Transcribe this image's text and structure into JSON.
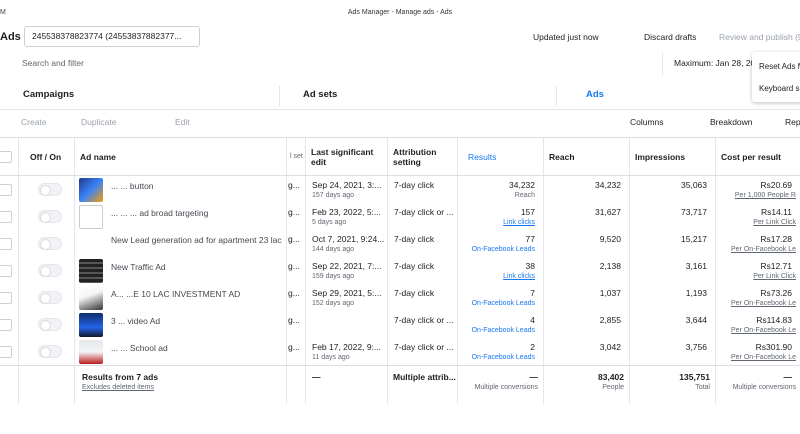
{
  "window": {
    "corner": "M",
    "title": "Ads Manager - Manage ads - Ads"
  },
  "topbar": {
    "ads_label": "Ads",
    "account": "245538378823774 (24553837882377...",
    "updated": "Updated just now",
    "discard": "Discard drafts",
    "review": "Review and publish (9"
  },
  "search": {
    "placeholder": "Search and filter",
    "max_date": "Maximum: Jan 28, 20"
  },
  "dropdown": {
    "items": [
      "Reset Ads M",
      "Keyboard s"
    ]
  },
  "tabs": {
    "campaigns": "Campaigns",
    "adsets": "Ad sets",
    "ads": "Ads"
  },
  "toolbar": {
    "create": "Create",
    "duplicate": "Duplicate",
    "edit": "Edit",
    "columns": "Columns",
    "breakdown": "Breakdown",
    "reports": "Rep"
  },
  "table": {
    "headers": {
      "off_on": "Off / On",
      "ad_name": "Ad name",
      "ad_set": "l set",
      "last_edit": "Last significant edit",
      "attribution": "Attribution setting",
      "results": "Results",
      "reach": "Reach",
      "impressions": "Impressions",
      "cost": "Cost per result"
    },
    "rows": [
      {
        "name": "... ... button",
        "adset": "g...",
        "edit": "Sep 24, 2021, 3:...",
        "edit_ago": "157 days ago",
        "attr": "7-day click",
        "results": "34,232",
        "results_sub": "Reach",
        "reach": "34,232",
        "impr": "35,063",
        "cost": "Rs20.69",
        "cost_sub": "Per 1,000 People R"
      },
      {
        "name": "... ... ... ad broad targeting",
        "adset": "g...",
        "edit": "Feb 23, 2022, 5:...",
        "edit_ago": "5 days ago",
        "attr": "7-day click or ...",
        "results": "157",
        "results_sub": "Link clicks",
        "reach": "31,627",
        "impr": "73,717",
        "cost": "Rs14.11",
        "cost_sub": "Per Link Click"
      },
      {
        "name": "New Lead generation ad for apartment 23 lac",
        "adset": "g...",
        "edit": "Oct 7, 2021, 9:24...",
        "edit_ago": "144 days ago",
        "attr": "7-day click",
        "results": "77",
        "results_sub": "On-Facebook Leads",
        "reach": "9,520",
        "impr": "15,217",
        "cost": "Rs17.28",
        "cost_sub": "Per On-Facebook Le"
      },
      {
        "name": "New Traffic Ad",
        "adset": "g...",
        "edit": "Sep 22, 2021, 7:...",
        "edit_ago": "159 days ago",
        "attr": "7-day click",
        "results": "38",
        "results_sub": "Link clicks",
        "reach": "2,138",
        "impr": "3,161",
        "cost": "Rs12.71",
        "cost_sub": "Per Link Click"
      },
      {
        "name": "A... ...E 10 LAC INVESTMENT AD",
        "adset": "g...",
        "edit": "Sep 29, 2021, 5:...",
        "edit_ago": "152 days ago",
        "attr": "7-day click",
        "results": "7",
        "results_sub": "On-Facebook Leads",
        "reach": "1,037",
        "impr": "1,193",
        "cost": "Rs73.26",
        "cost_sub": "Per On-Facebook Le"
      },
      {
        "name": "3 ... video Ad",
        "adset": "g...",
        "edit": "",
        "edit_ago": "",
        "attr": "7-day click or ...",
        "results": "4",
        "results_sub": "On-Facebook Leads",
        "reach": "2,855",
        "impr": "3,644",
        "cost": "Rs114.83",
        "cost_sub": "Per On-Facebook Le"
      },
      {
        "name": "... ... School ad",
        "adset": "g...",
        "edit": "Feb 17, 2022, 9:...",
        "edit_ago": "11 days ago",
        "attr": "7-day click or ...",
        "results": "2",
        "results_sub": "On-Facebook Leads",
        "reach": "3,042",
        "impr": "3,756",
        "cost": "Rs301.90",
        "cost_sub": "Per On-Facebook Le"
      }
    ],
    "totals": {
      "label": "Results from 7 ads",
      "sub": "Excludes deleted items",
      "edit": "—",
      "attr": "Multiple attrib...",
      "results": "—",
      "results_sub": "Multiple conversions",
      "reach": "83,402",
      "reach_sub": "People",
      "impr": "135,751",
      "impr_sub": "Total",
      "cost": "—",
      "cost_sub": "Multiple conversions"
    }
  }
}
